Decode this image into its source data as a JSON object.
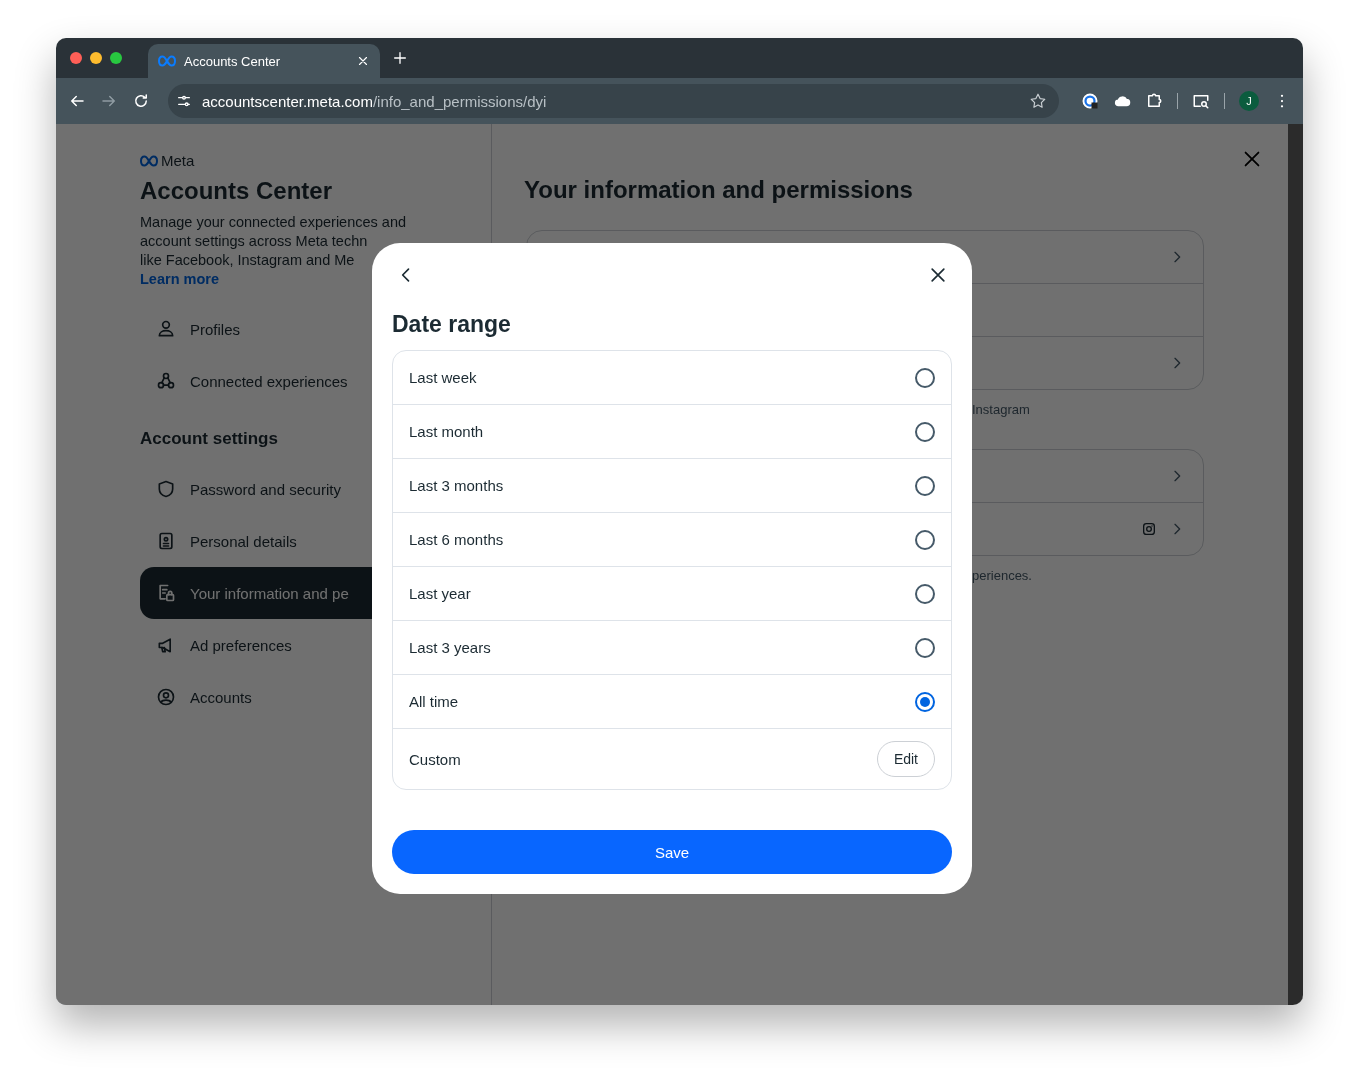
{
  "browser": {
    "tab_title": "Accounts Center",
    "url_host": "accountscenter.meta.com",
    "url_path": "/info_and_permissions/dyi",
    "avatar": "J"
  },
  "sidebar": {
    "brand": "Meta",
    "title": "Accounts Center",
    "description": [
      "Manage your connected experiences and",
      "account settings across Meta techn",
      "like Facebook, Instagram and Me"
    ],
    "learn_more": "Learn more",
    "top_items": [
      {
        "label": "Profiles",
        "selected": false
      },
      {
        "label": "Connected experiences",
        "selected": false
      }
    ],
    "section": "Account settings",
    "items": [
      {
        "label": "Password and security",
        "selected": false
      },
      {
        "label": "Personal details",
        "selected": false
      },
      {
        "label": "Your information and pe",
        "selected": true
      },
      {
        "label": "Ad preferences",
        "selected": false
      },
      {
        "label": "Accounts",
        "selected": false
      }
    ]
  },
  "main": {
    "title": "Your information and permissions",
    "notes": [
      "Instagram",
      "periences."
    ]
  },
  "modal": {
    "title": "Date range",
    "options": [
      {
        "label": "Last week",
        "selected": false
      },
      {
        "label": "Last month",
        "selected": false
      },
      {
        "label": "Last 3 months",
        "selected": false
      },
      {
        "label": "Last 6 months",
        "selected": false
      },
      {
        "label": "Last year",
        "selected": false
      },
      {
        "label": "Last 3 years",
        "selected": false
      },
      {
        "label": "All time",
        "selected": true
      }
    ],
    "custom": {
      "label": "Custom",
      "button": "Edit"
    },
    "save": "Save"
  }
}
